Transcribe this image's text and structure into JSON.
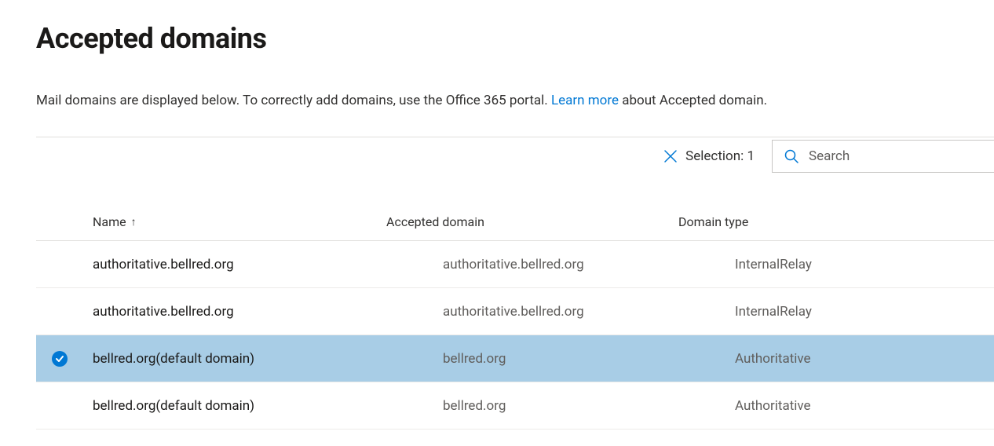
{
  "title": "Accepted domains",
  "description_prefix": "Mail domains are displayed below. To correctly add domains, use the Office 365 portal. ",
  "learn_more_label": "Learn more",
  "description_suffix": " about Accepted domain.",
  "selection_label": "Selection: 1",
  "search": {
    "placeholder": "Search"
  },
  "columns": {
    "name": "Name",
    "domain": "Accepted domain",
    "type": "Domain type"
  },
  "rows": [
    {
      "name": "authoritative.bellred.org",
      "domain": "authoritative.bellred.org",
      "type": "InternalRelay",
      "selected": false
    },
    {
      "name": "authoritative.bellred.org",
      "domain": "authoritative.bellred.org",
      "type": "InternalRelay",
      "selected": false
    },
    {
      "name": "bellred.org(default domain)",
      "domain": "bellred.org",
      "type": "Authoritative",
      "selected": true
    },
    {
      "name": "bellred.org(default domain)",
      "domain": "bellred.org",
      "type": "Authoritative",
      "selected": false
    }
  ]
}
